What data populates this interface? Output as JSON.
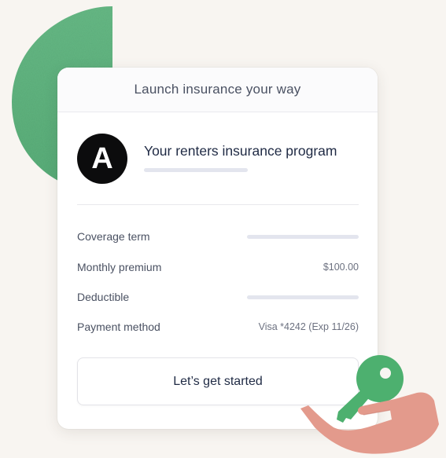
{
  "card": {
    "header_title": "Launch insurance your way",
    "program": {
      "avatar_letter": "A",
      "title": "Your renters insurance program"
    },
    "details": [
      {
        "label": "Coverage term",
        "value": ""
      },
      {
        "label": "Monthly premium",
        "value": "$100.00"
      },
      {
        "label": "Deductible",
        "value": ""
      },
      {
        "label": "Payment method",
        "value": "Visa *4242 (Exp 11/26)"
      }
    ],
    "cta_label": "Let’s get started"
  },
  "colors": {
    "background": "#f8f5f1",
    "leaf_green": "#5fb47e",
    "key_green": "#4db06f",
    "hand_pink": "#e39a8c",
    "avatar_black": "#0c0c0d",
    "text_dark": "#1f2a44",
    "placeholder_bar": "#e3e5ee"
  },
  "icons": [
    "leaf-decoration",
    "key-icon",
    "hand-icon"
  ]
}
